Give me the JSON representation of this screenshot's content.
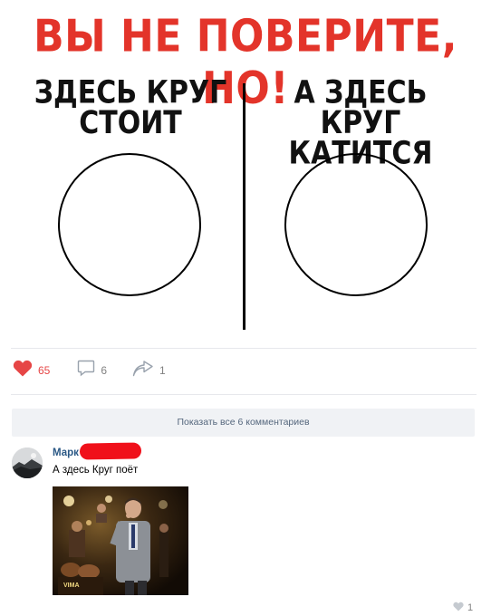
{
  "meme": {
    "headline": "ВЫ НЕ ПОВЕРИТЕ, НО!",
    "left_caption_line1": "ЗДЕСЬ КРУГ",
    "left_caption_line2": "СТОИТ",
    "right_caption_line1": "А ЗДЕСЬ КРУГ",
    "right_caption_line2": "КАТИТСЯ"
  },
  "post_actions": {
    "likes": "65",
    "comments": "6",
    "shares": "1"
  },
  "comments": {
    "show_all_label": "Показать все 6 комментариев",
    "items": [
      {
        "author": "Марк",
        "text": "А здесь Круг поёт",
        "photo_caption": "VIMA",
        "likes": "1"
      }
    ]
  },
  "colors": {
    "headline": "#e3342a",
    "like": "#e64646",
    "link": "#2a5885",
    "redaction": "#f0101a"
  }
}
